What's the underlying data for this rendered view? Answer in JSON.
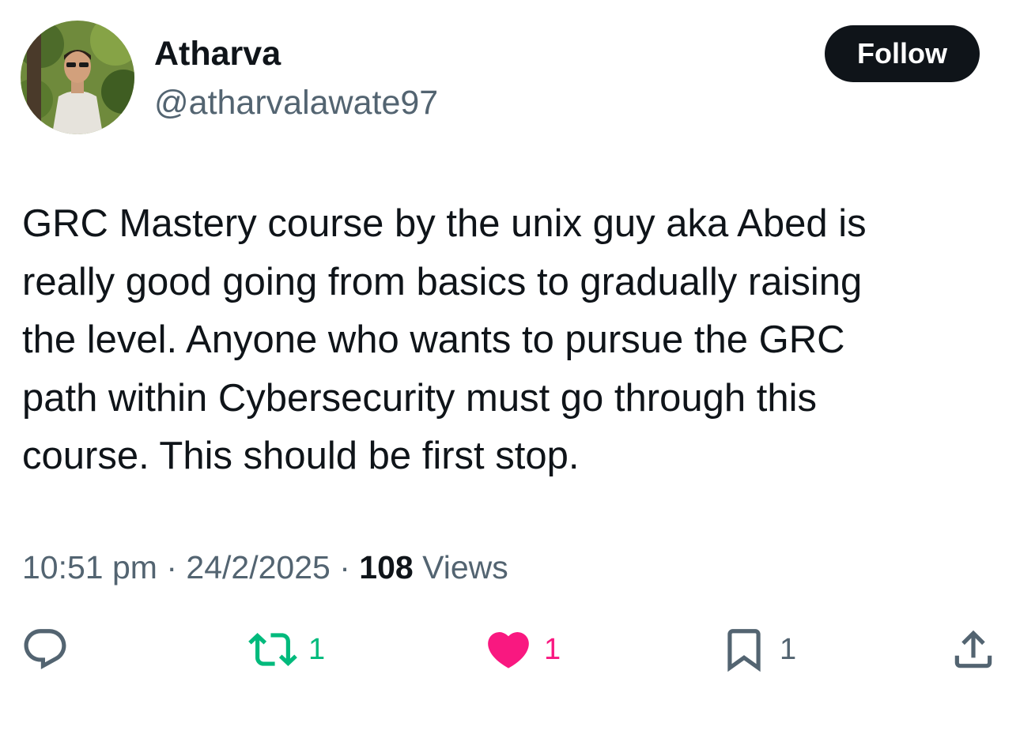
{
  "author": {
    "display_name": "Atharva",
    "handle": "@atharvalawate97"
  },
  "follow_button": {
    "label": "Follow"
  },
  "tweet": {
    "text_lines": [
      "GRC Mastery course by the unix guy aka Abed is",
      "really good going from basics to gradually raising",
      "the level. Anyone who wants to pursue the GRC",
      "path within Cybersecurity must go through this",
      "course. This should be first stop."
    ]
  },
  "meta": {
    "time": "10:51 pm",
    "separator": "·",
    "date": "24/2/2025",
    "views_count": "108",
    "views_label": "Views"
  },
  "actions": {
    "reply": {
      "icon": "reply-icon"
    },
    "retweet": {
      "icon": "retweet-icon",
      "count": "1",
      "color": "#00ba7c"
    },
    "like": {
      "icon": "heart-icon",
      "count": "1",
      "color": "#f91880",
      "liked": true
    },
    "bookmark": {
      "icon": "bookmark-icon",
      "count": "1"
    },
    "share": {
      "icon": "share-icon"
    }
  },
  "colors": {
    "text_primary": "#0f1419",
    "text_secondary": "#536471",
    "icon_gray": "#536471",
    "follow_bg": "#0f1419"
  }
}
